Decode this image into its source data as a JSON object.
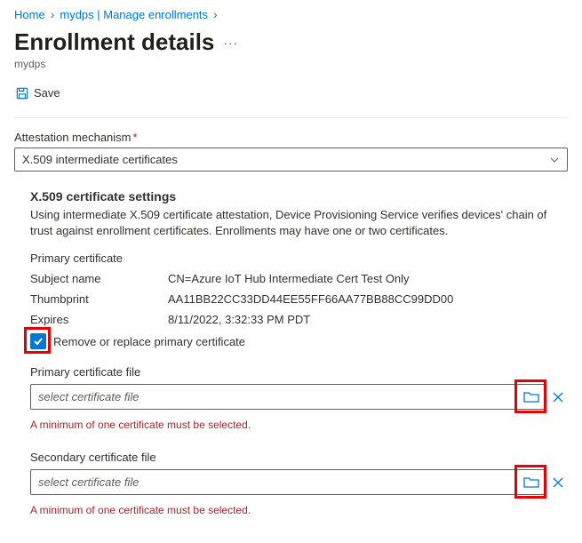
{
  "breadcrumb": {
    "home": "Home",
    "parent": "mydps | Manage enrollments"
  },
  "page": {
    "title": "Enrollment details",
    "subtitle": "mydps"
  },
  "toolbar": {
    "save_label": "Save"
  },
  "attestation": {
    "label": "Attestation mechanism",
    "value": "X.509 intermediate certificates"
  },
  "x509": {
    "heading": "X.509 certificate settings",
    "description": "Using intermediate X.509 certificate attestation, Device Provisioning Service verifies devices' chain of trust against enrollment certificates. Enrollments may have one or two certificates.",
    "primary_label": "Primary certificate",
    "kv": {
      "subject_label": "Subject name",
      "subject_value": "CN=Azure IoT Hub Intermediate Cert Test Only",
      "thumbprint_label": "Thumbprint",
      "thumbprint_value": "AA11BB22CC33DD44EE55FF66AA77BB88CC99DD00",
      "expires_label": "Expires",
      "expires_value": "8/11/2022, 3:32:33 PM PDT"
    },
    "remove_replace_label": "Remove or replace primary certificate",
    "primary_file_label": "Primary certificate file",
    "secondary_file_label": "Secondary certificate file",
    "file_placeholder": "select certificate file",
    "error_text": "A minimum of one certificate must be selected."
  }
}
